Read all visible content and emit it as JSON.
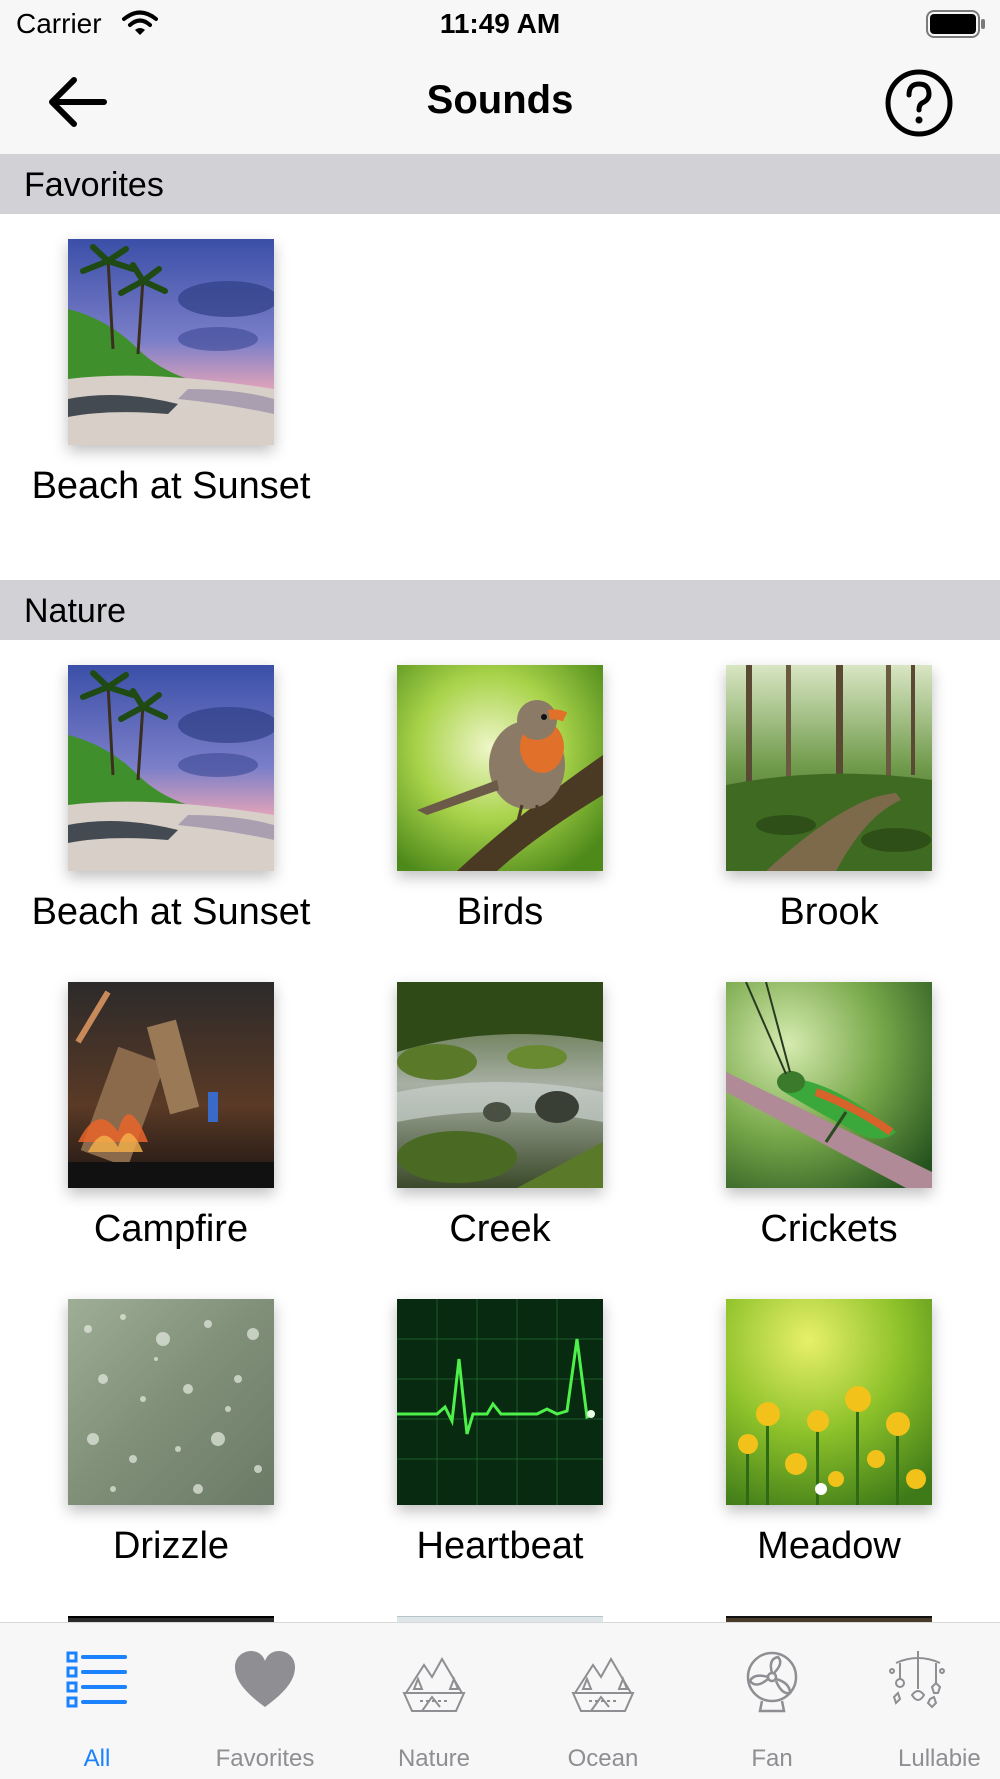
{
  "status": {
    "carrier": "Carrier",
    "time": "11:49 AM"
  },
  "nav": {
    "title": "Sounds",
    "back_icon": "arrow-left-icon",
    "help_icon": "question-circle-icon"
  },
  "sections": {
    "favorites": {
      "title": "Favorites",
      "items": [
        {
          "label": "Beach at Sunset",
          "image": "beach-sunset"
        }
      ]
    },
    "nature": {
      "title": "Nature",
      "items": [
        {
          "label": "Beach at Sunset",
          "image": "beach-sunset"
        },
        {
          "label": "Birds",
          "image": "robin-bird"
        },
        {
          "label": "Brook",
          "image": "forest-brook"
        },
        {
          "label": "Campfire",
          "image": "campfire"
        },
        {
          "label": "Creek",
          "image": "mossy-creek"
        },
        {
          "label": "Crickets",
          "image": "grasshopper"
        },
        {
          "label": "Drizzle",
          "image": "raindrops-window"
        },
        {
          "label": "Heartbeat",
          "image": "ecg-monitor"
        },
        {
          "label": "Meadow",
          "image": "yellow-flowers"
        }
      ]
    }
  },
  "tabs": [
    {
      "label": "All",
      "icon": "list-icon",
      "active": true
    },
    {
      "label": "Favorites",
      "icon": "heart-icon",
      "active": false
    },
    {
      "label": "Nature",
      "icon": "nature-scene-icon",
      "active": false
    },
    {
      "label": "Ocean",
      "icon": "ocean-scene-icon",
      "active": false
    },
    {
      "label": "Fan",
      "icon": "fan-icon",
      "active": false
    },
    {
      "label": "Lullabie",
      "icon": "lullaby-mobile-icon",
      "active": false
    }
  ],
  "colors": {
    "accent": "#1a82ff",
    "inactive": "#8e8e93",
    "section_header": "#d1d1d6",
    "bars": "#f7f7f7"
  }
}
